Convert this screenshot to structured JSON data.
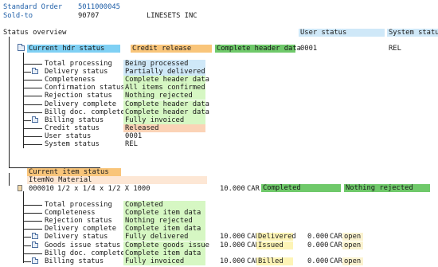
{
  "header": {
    "standard_order_label": "Standard Order",
    "standard_order_value": "5011000045",
    "soldto_label": "Sold-to",
    "soldto_value": "90707",
    "customer_name": "LINESETS INC"
  },
  "overview": {
    "title": "Status overview",
    "user_status_col": "User status",
    "system_status_col": "System status"
  },
  "header_status": {
    "label": "Current hdr status",
    "credit": "Credit release",
    "completeness": "Complete header data",
    "user_status": "0001",
    "system_status": "REL"
  },
  "header_details": [
    {
      "label": "Total processing",
      "value": "Being processed"
    },
    {
      "label": "Delivery status",
      "value": "Partially delivered"
    },
    {
      "label": "Completeness",
      "value": "Complete header data"
    },
    {
      "label": "Confirmation status",
      "value": "All items confirmed"
    },
    {
      "label": "Rejection status",
      "value": "Nothing rejected"
    },
    {
      "label": "Delivery complete",
      "value": "Complete header data"
    },
    {
      "label": "Billg doc. complete",
      "value": "Complete header data"
    },
    {
      "label": "Billing status",
      "value": "Fully invoiced"
    },
    {
      "label": "Credit status",
      "value": "Released"
    },
    {
      "label": "User status",
      "value": "0001"
    },
    {
      "label": "System status",
      "value": "REL"
    }
  ],
  "item_section": {
    "title": "Current item status",
    "subtitle": "ItemNo Material",
    "item_number": "000010",
    "material": "1/2 x 1/4 x 1/2 X 1000",
    "quantity": "10.000",
    "unit": "CAR",
    "status": "Completed",
    "rejection": "Nothing rejected"
  },
  "item_details": [
    {
      "label": "Total processing",
      "value": "Completed"
    },
    {
      "label": "Completeness",
      "value": "Complete item data"
    },
    {
      "label": "Rejection status",
      "value": "Nothing rejected"
    },
    {
      "label": "Delivery complete",
      "value": "Complete item data"
    },
    {
      "label": "Delivery status",
      "value": "Fully delivered",
      "qty1": "10.000",
      "unit1": "CAR",
      "status1": "Delivered",
      "qty2": "0.000",
      "unit2": "CAR",
      "status2": "open"
    },
    {
      "label": "Goods issue status",
      "value": "Complete goods issue",
      "qty1": "10.000",
      "unit1": "CAR",
      "status1": "Issued",
      "qty2": "0.000",
      "unit2": "CAR",
      "status2": "open"
    },
    {
      "label": "Billg doc. complete",
      "value": "Complete item data"
    },
    {
      "label": "Billing status",
      "value": "Fully invoiced",
      "qty1": "10.000",
      "unit1": "CAR",
      "status1": "Billed",
      "qty2": "0.000",
      "unit2": "CAR",
      "status2": "open"
    }
  ]
}
